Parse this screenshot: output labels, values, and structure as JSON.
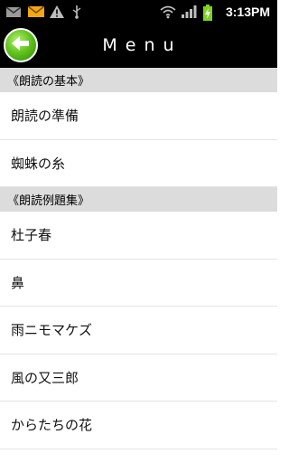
{
  "status_bar": {
    "icons_left": [
      "gmail-icon",
      "envelope-icon",
      "warning-icon",
      "usb-icon"
    ],
    "icons_right": [
      "wifi-icon",
      "signal-icon",
      "battery-charging-icon"
    ],
    "time": "3:13PM"
  },
  "header": {
    "title": "Menu",
    "back_icon": "back-arrow-icon"
  },
  "sections": [
    {
      "title": "《朗読の基本》",
      "items": [
        "朗読の準備",
        "蜘蛛の糸"
      ]
    },
    {
      "title": "《朗読例題集》",
      "items": [
        "杜子春",
        "鼻",
        "雨ニモマケズ",
        "風の又三郎",
        "からたちの花"
      ]
    }
  ],
  "colors": {
    "bar_background": "#000000",
    "section_header": "#dcdcdc",
    "back_button": "#63c41e",
    "battery": "#7ed321"
  }
}
